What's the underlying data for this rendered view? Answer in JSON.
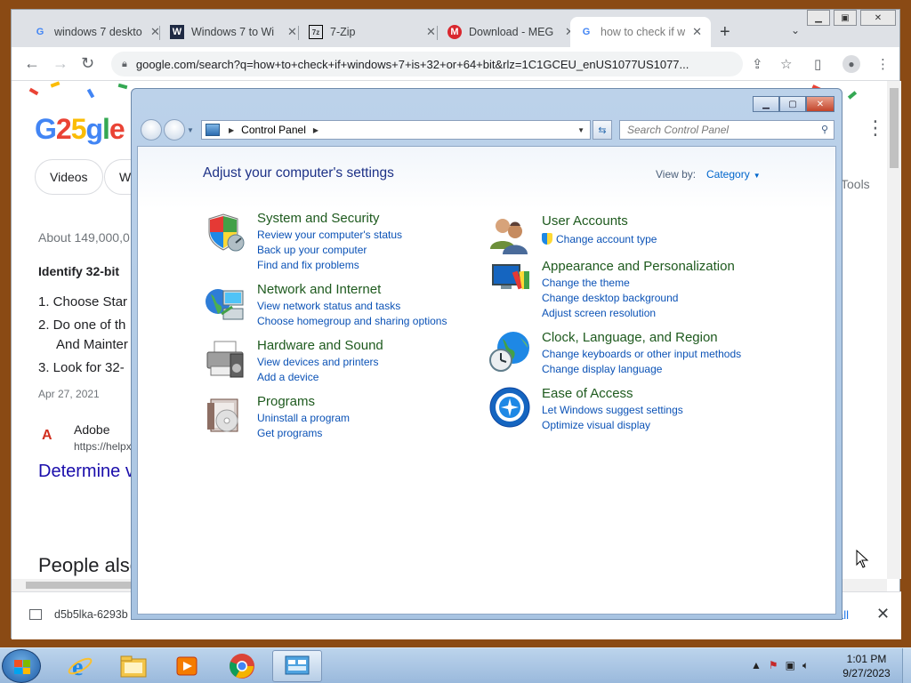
{
  "browser": {
    "tabs": [
      {
        "title": "windows 7 deskto",
        "favicon": "G"
      },
      {
        "title": "Windows 7 to Wi",
        "favicon": "W"
      },
      {
        "title": "7-Zip",
        "favicon": "7z"
      },
      {
        "title": "Download - MEG",
        "favicon": "M"
      },
      {
        "title": "how to check if w",
        "favicon": "G"
      }
    ],
    "url": "google.com/search?q=how+to+check+if+windows+7+is+32+or+64+bit&rlz=1C1GCEU_enUS1077US1077...",
    "download_file": "d5b5lka-6293b",
    "download_showall": "all"
  },
  "google_page": {
    "logo": "G25gle",
    "chips": [
      "Videos",
      "Wi"
    ],
    "tools": "Tools",
    "results_count": "About 149,000,0",
    "snippet_title": "Identify 32-bit",
    "list": [
      "1. Choose Star",
      "2. Do one of th",
      "And Mainter",
      "3. Look for 32-"
    ],
    "date": "Apr 27, 2021",
    "source_name": "Adobe",
    "source_url": "https://helpx",
    "link_title": "Determine v",
    "people_also": "People also"
  },
  "control_panel": {
    "address": "Control Panel",
    "search_placeholder": "Search Control Panel",
    "heading": "Adjust your computer's settings",
    "view_by_label": "View by:",
    "view_by_value": "Category",
    "left_categories": [
      {
        "title": "System and Security",
        "icon": "shield-icon",
        "links": [
          "Review your computer's status",
          "Back up your computer",
          "Find and fix problems"
        ]
      },
      {
        "title": "Network and Internet",
        "icon": "network-icon",
        "links": [
          "View network status and tasks",
          "Choose homegroup and sharing options"
        ]
      },
      {
        "title": "Hardware and Sound",
        "icon": "printer-icon",
        "links": [
          "View devices and printers",
          "Add a device"
        ]
      },
      {
        "title": "Programs",
        "icon": "programs-icon",
        "links": [
          "Uninstall a program",
          "Get programs"
        ]
      }
    ],
    "right_categories": [
      {
        "title": "User Accounts",
        "icon": "users-icon",
        "links": [
          "Change account type"
        ]
      },
      {
        "title": "Appearance and Personalization",
        "icon": "appearance-icon",
        "links": [
          "Change the theme",
          "Change desktop background",
          "Adjust screen resolution"
        ]
      },
      {
        "title": "Clock, Language, and Region",
        "icon": "clock-globe-icon",
        "links": [
          "Change keyboards or other input methods",
          "Change display language"
        ]
      },
      {
        "title": "Ease of Access",
        "icon": "ease-of-access-icon",
        "links": [
          "Let Windows suggest settings",
          "Optimize visual display"
        ]
      }
    ]
  },
  "taskbar": {
    "time": "1:01 PM",
    "date": "9/27/2023"
  }
}
